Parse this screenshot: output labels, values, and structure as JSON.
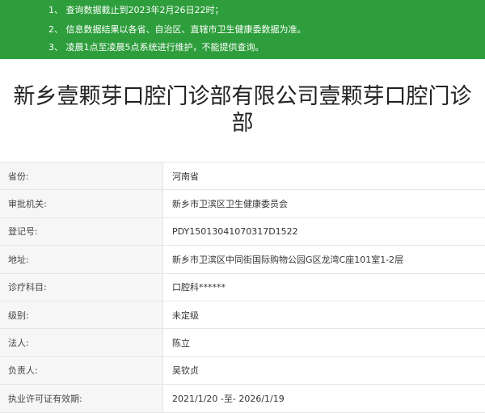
{
  "notice": {
    "lines": [
      "1、 查询数据截止到2023年2月26日22时；",
      "2、 信息数据结果以各省、自治区、直辖市卫生健康委数据为准。",
      "3、 凌晨1点至凌晨5点系统进行维护，不能提供查询。"
    ]
  },
  "clinic": {
    "name": "新乡壹颗芽口腔门诊部有限公司壹颗芽口腔门诊部"
  },
  "fields": [
    {
      "label": "省份:",
      "value": "河南省"
    },
    {
      "label": "审批机关:",
      "value": "新乡市卫滨区卫生健康委员会"
    },
    {
      "label": "登记号:",
      "value": "PDY15013041070317D1522"
    },
    {
      "label": "地址:",
      "value": "新乡市卫滨区中同街国际购物公园G区龙湾C座101室1-2层"
    },
    {
      "label": "诊疗科目:",
      "value": "口腔科******"
    },
    {
      "label": "级别:",
      "value": "未定级"
    },
    {
      "label": "法人:",
      "value": "陈立"
    },
    {
      "label": "负责人:",
      "value": "吴钦贞"
    },
    {
      "label": "执业许可证有效期:",
      "value": "2021/1/20 -至- 2026/1/19"
    }
  ],
  "colors": {
    "notice_bg": "#2e9e3c",
    "label_bg": "#f6f6f6",
    "border": "#e6e6e6"
  }
}
